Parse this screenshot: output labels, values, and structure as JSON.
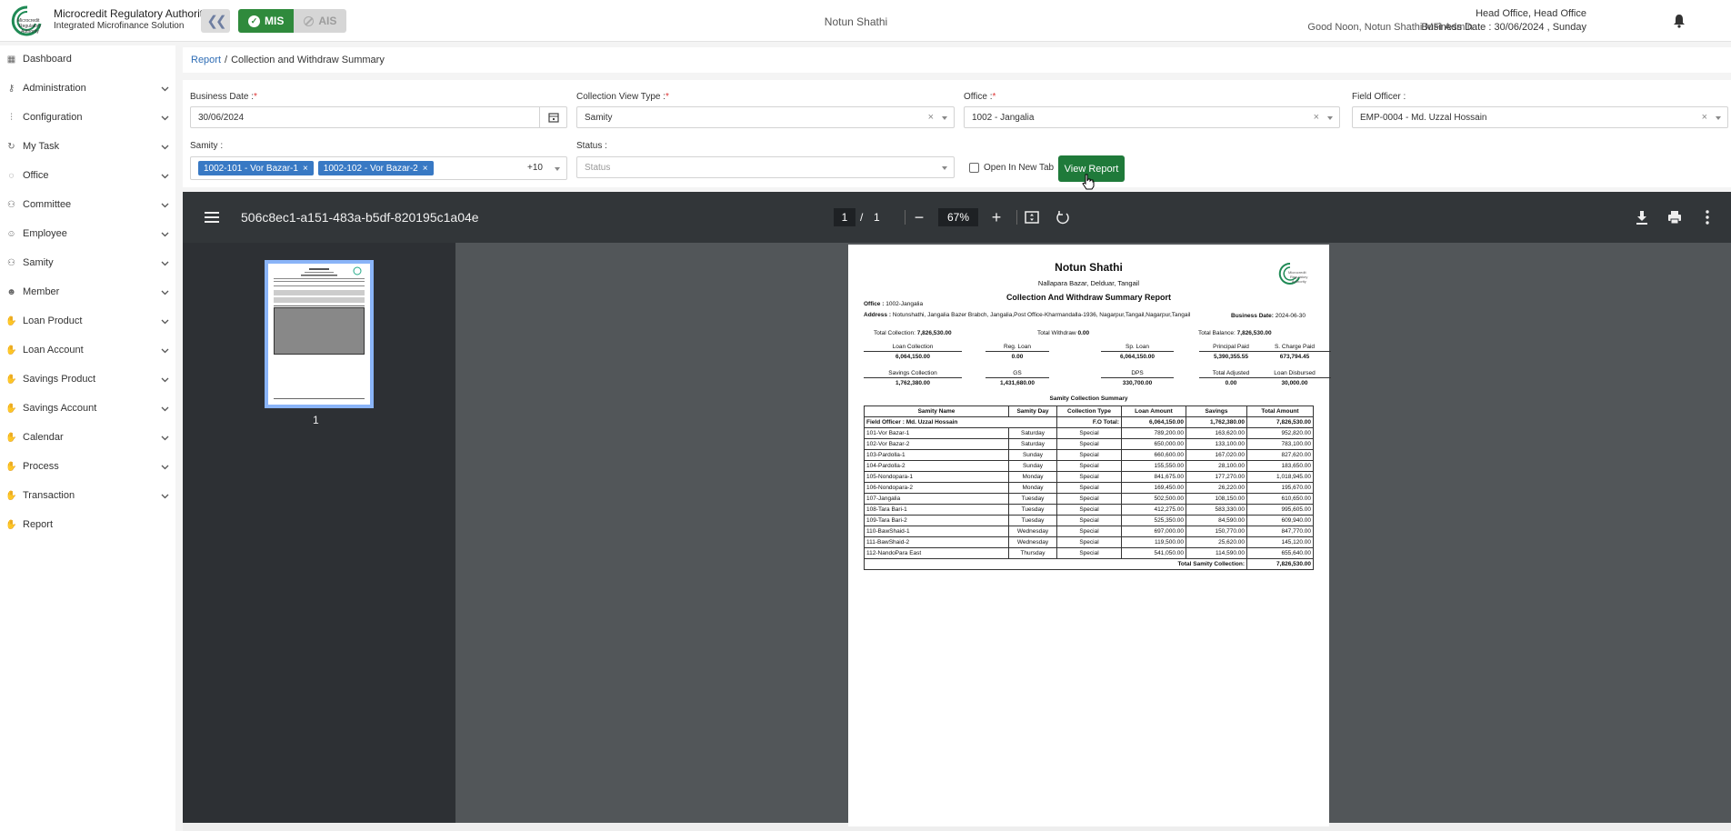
{
  "brand": {
    "title": "Microcredit Regulatory Authority",
    "subtitle": "Integrated Microfinance Solution",
    "logo_text": "Microcredit Regulatory Authority"
  },
  "header": {
    "mode_mis": "MIS",
    "mode_ais": "AIS",
    "org_name": "Notun Shathi",
    "greeting": "Good Noon, Notun Shathi MFI Admin",
    "office_name": "Head Office, Head Office",
    "business_date": "Business Date : 30/06/2024 , Sunday"
  },
  "sidebar": {
    "items": [
      {
        "label": "Dashboard",
        "icon": "grid-icon"
      },
      {
        "label": "Administration",
        "icon": "key-icon"
      },
      {
        "label": "Configuration",
        "icon": "sliders-icon"
      },
      {
        "label": "My Task",
        "icon": "refresh-icon"
      },
      {
        "label": "Office",
        "icon": "circle-icon"
      },
      {
        "label": "Committee",
        "icon": "users-icon"
      },
      {
        "label": "Employee",
        "icon": "user-icon"
      },
      {
        "label": "Samity",
        "icon": "group-icon"
      },
      {
        "label": "Member",
        "icon": "member-icon"
      },
      {
        "label": "Loan Product",
        "icon": "hand-icon"
      },
      {
        "label": "Loan Account",
        "icon": "hand-icon"
      },
      {
        "label": "Savings Product",
        "icon": "hand-icon"
      },
      {
        "label": "Savings Account",
        "icon": "hand-icon"
      },
      {
        "label": "Calendar",
        "icon": "hand-icon"
      },
      {
        "label": "Process",
        "icon": "hand-icon"
      },
      {
        "label": "Transaction",
        "icon": "hand-icon"
      },
      {
        "label": "Report",
        "icon": "hand-icon"
      }
    ]
  },
  "breadcrumb": {
    "root": "Report",
    "separator": "/",
    "current": "Collection and Withdraw Summary"
  },
  "filters": {
    "business_date_label": "Business Date :",
    "business_date_value": "30/06/2024",
    "view_type_label": "Collection View Type :",
    "view_type_value": "Samity",
    "office_label": "Office :",
    "office_value": "1002 - Jangalia",
    "officer_label": "Field Officer :",
    "officer_value": "EMP-0004 - Md. Uzzal Hossain",
    "samity_label": "Samity :",
    "samity_chips": [
      "1002-101 - Vor Bazar-1",
      "1002-102 - Vor Bazar-2"
    ],
    "samity_more": "+10",
    "status_label": "Status :",
    "status_placeholder": "Status",
    "required_mark": "*",
    "open_new_tab": "Open In New Tab",
    "view_report": "View Report"
  },
  "pdf": {
    "title": "506c8ec1-a151-483a-b5df-820195c1a04e",
    "page_current": "1",
    "page_slash": "/",
    "page_total": "1",
    "zoom": "67%",
    "thumb_number": "1"
  },
  "report": {
    "org": "Notun Shathi",
    "org_address": "Nallapara Bazar, Delduar, Tangail",
    "title": "Collection And Withdraw Summary Report",
    "office_label": "Office :",
    "office_value": "1002-Jangalia",
    "address_label": "Address :",
    "address_value": "Notunshathi, Jangalia Bazer Brabch, Jangalia,Post Office-Kharmandalla-1936, Nagarpur,Tangail,Nagarpur,Tangail",
    "bdate_label": "Business Date:",
    "bdate_value": "2024-06-30",
    "total_collection_label": "Total Collection:",
    "total_collection_value": "7,826,530.00",
    "total_withdraw_label": "Total Withdraw",
    "total_withdraw_value": "0.00",
    "total_balance_label": "Total Balance:",
    "total_balance_value": "7,826,530.00",
    "summary_row1": [
      {
        "label": "Loan Collection",
        "value": "6,064,150.00"
      },
      {
        "label": "Reg. Loan",
        "value": "0.00"
      },
      {
        "label": "Sp. Loan",
        "value": "6,064,150.00"
      },
      {
        "label": "Principal Paid",
        "value": "5,390,355.55"
      },
      {
        "label": "S. Charge Paid",
        "value": "673,794.45"
      }
    ],
    "summary_row2": [
      {
        "label": "Savings Collection",
        "value": "1,762,380.00"
      },
      {
        "label": "GS",
        "value": "1,431,680.00"
      },
      {
        "label": "DPS",
        "value": "330,700.00"
      },
      {
        "label": "Total Adjusted",
        "value": "0.00"
      },
      {
        "label": "Loan Disbursed",
        "value": "30,000.00"
      }
    ],
    "table_title": "Samity Collection Summary",
    "columns": [
      "Samity Name",
      "Samity Day",
      "Collection Type",
      "Loan Amount",
      "Savings",
      "Total Amount"
    ],
    "fo_row": {
      "label": "Field Officer : Md. Uzzal Hossain",
      "total_label": "F.O Total:",
      "loan": "6,064,150.00",
      "savings": "1,762,380.00",
      "total": "7,826,530.00"
    },
    "rows": [
      [
        "101-Vor Bazar-1",
        "Saturday",
        "Special",
        "789,200.00",
        "163,620.00",
        "952,820.00"
      ],
      [
        "102-Vor Bazar-2",
        "Saturday",
        "Special",
        "650,000.00",
        "133,100.00",
        "783,100.00"
      ],
      [
        "103-Pardolla-1",
        "Sunday",
        "Special",
        "660,600.00",
        "167,020.00",
        "827,620.00"
      ],
      [
        "104-Pardolla-2",
        "Sunday",
        "Special",
        "155,550.00",
        "28,100.00",
        "183,650.00"
      ],
      [
        "105-Nondopara-1",
        "Monday",
        "Special",
        "841,675.00",
        "177,270.00",
        "1,018,945.00"
      ],
      [
        "106-Nondopara-2",
        "Monday",
        "Special",
        "169,450.00",
        "26,220.00",
        "195,670.00"
      ],
      [
        "107-Jangalia",
        "Tuesday",
        "Special",
        "502,500.00",
        "108,150.00",
        "610,650.00"
      ],
      [
        "108-Tara Bari-1",
        "Tuesday",
        "Special",
        "412,275.00",
        "583,330.00",
        "995,605.00"
      ],
      [
        "109-Tara Bari-2",
        "Tuesday",
        "Special",
        "525,350.00",
        "84,590.00",
        "609,940.00"
      ],
      [
        "110-BawShaid-1",
        "Wednesday",
        "Special",
        "697,000.00",
        "150,770.00",
        "847,770.00"
      ],
      [
        "111-BawShaid-2",
        "Wednesday",
        "Special",
        "119,500.00",
        "25,620.00",
        "145,120.00"
      ],
      [
        "112-NandoPara East",
        "Thursday",
        "Special",
        "541,050.00",
        "114,590.00",
        "655,640.00"
      ]
    ],
    "grand_total_label": "Total Samity Collection:",
    "grand_total_value": "7,826,530.00"
  },
  "colors": {
    "accent": "#2f8a3c",
    "link": "#2f6db5",
    "chip": "#3879c4",
    "pdf_toolbar": "#323639",
    "pdf_canvas": "#525659"
  }
}
